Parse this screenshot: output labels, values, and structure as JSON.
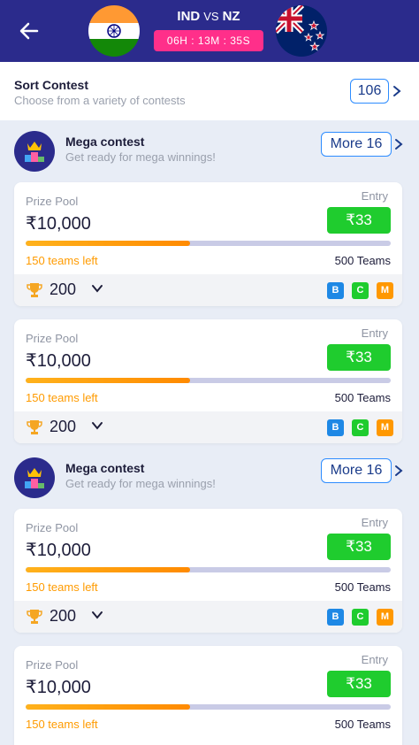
{
  "header": {
    "team1": "IND",
    "vs": "VS",
    "team2": "NZ",
    "timer": "06H : 13M : 35S"
  },
  "sort": {
    "title": "Sort Contest",
    "subtitle": "Choose from a variety of contests",
    "count": "106"
  },
  "sections": [
    {
      "title": "Mega contest",
      "subtitle": "Get ready for mega winnings!",
      "more_label": "More 16",
      "cards": [
        {
          "prize_label": "Prize Pool",
          "prize": "₹10,000",
          "entry_label": "Entry",
          "entry": "₹33",
          "fill_fraction": 0.45,
          "teams_left": "150 teams left",
          "total_teams": "500 Teams",
          "winners": "200",
          "badges": [
            "B",
            "C",
            "M"
          ]
        },
        {
          "prize_label": "Prize Pool",
          "prize": "₹10,000",
          "entry_label": "Entry",
          "entry": "₹33",
          "fill_fraction": 0.45,
          "teams_left": "150 teams left",
          "total_teams": "500 Teams",
          "winners": "200",
          "badges": [
            "B",
            "C",
            "M"
          ]
        }
      ]
    },
    {
      "title": "Mega contest",
      "subtitle": "Get ready for mega winnings!",
      "more_label": "More 16",
      "cards": [
        {
          "prize_label": "Prize Pool",
          "prize": "₹10,000",
          "entry_label": "Entry",
          "entry": "₹33",
          "fill_fraction": 0.45,
          "teams_left": "150 teams left",
          "total_teams": "500 Teams",
          "winners": "200",
          "badges": [
            "B",
            "C",
            "M"
          ]
        },
        {
          "prize_label": "Prize Pool",
          "prize": "₹10,000",
          "entry_label": "Entry",
          "entry": "₹33",
          "fill_fraction": 0.45,
          "teams_left": "150 teams left",
          "total_teams": "500 Teams",
          "winners": "200",
          "badges": [
            "B",
            "C",
            "M"
          ]
        }
      ]
    }
  ],
  "colors": {
    "header_bg": "#2b2b8c",
    "timer_bg": "#ff2f8a",
    "entry_green": "#1fcc2e",
    "progress_orange": "#ff9b00",
    "badge_b": "#1e88e5",
    "badge_c": "#1fcc2e",
    "badge_m": "#ff9800"
  },
  "icons": {
    "back": "arrow-left-icon",
    "team1_flag": "india-flag-icon",
    "team2_flag": "new-zealand-flag-icon",
    "section": "crown-podium-icon",
    "winners": "trophy-icon",
    "expand": "chevron-down-icon",
    "more": "chevron-right-icon"
  }
}
